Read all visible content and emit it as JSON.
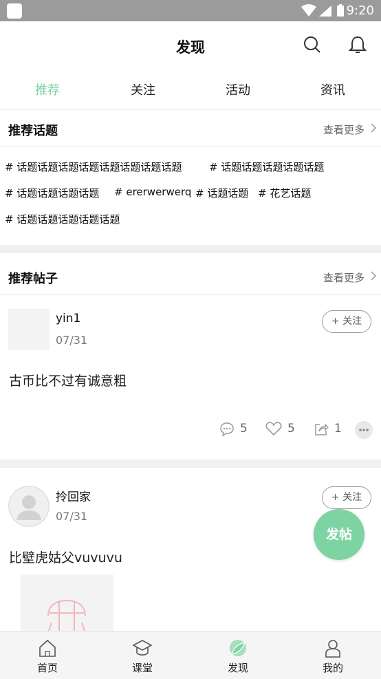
{
  "status_bar": {
    "time": "9:20"
  },
  "header": {
    "title": "发现"
  },
  "tabs": [
    {
      "label": "推荐",
      "active": true
    },
    {
      "label": "关注",
      "active": false
    },
    {
      "label": "活动",
      "active": false
    },
    {
      "label": "资讯",
      "active": false
    }
  ],
  "topics_section": {
    "title": "推荐话题",
    "more": "查看更多",
    "topics": [
      "# 话题话题话题话题话题话题话题话题",
      "# 话题话题话题话题话题",
      "# 话题话题话题话题",
      "# ererwerwerq",
      "# 话题话题",
      "# 花艺话题",
      "# 话题话题话题话题话题"
    ]
  },
  "posts_section": {
    "title": "推荐帖子",
    "more": "查看更多",
    "posts": [
      {
        "author": "yin1",
        "date": "07/31",
        "follow_label": "+ 关注",
        "text": "古币比不过有诚意粗",
        "comments": "5",
        "likes": "5",
        "shares": "1"
      },
      {
        "author": "拎回家",
        "date": "07/31",
        "follow_label": "+ 关注",
        "text": "比壁虎姑父vuvuvu"
      }
    ]
  },
  "fab": {
    "label": "发帖"
  },
  "bottom_nav": [
    {
      "label": "首页",
      "icon": "home-icon",
      "active": false
    },
    {
      "label": "课堂",
      "icon": "graduation-cap-icon",
      "active": false
    },
    {
      "label": "发现",
      "icon": "leaf-icon",
      "active": true
    },
    {
      "label": "我的",
      "icon": "profile-icon",
      "active": false
    }
  ],
  "colors": {
    "accent": "#7ed3a2",
    "status_bar": "#9b9b9b",
    "divider": "#f0f0f0"
  }
}
